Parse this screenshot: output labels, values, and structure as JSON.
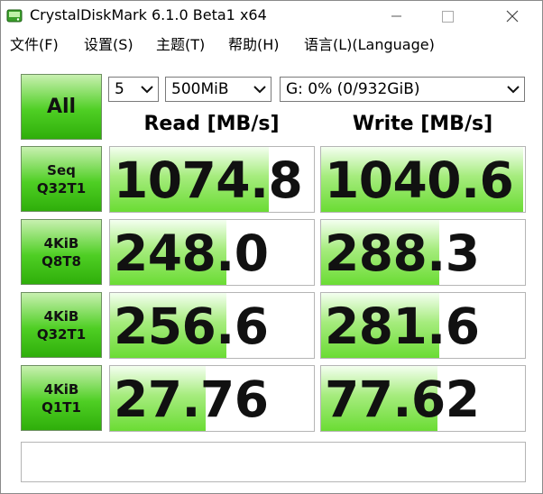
{
  "window": {
    "title": "CrystalDiskMark 6.1.0 Beta1 x64"
  },
  "menu": [
    "文件(F)",
    "设置(S)",
    "主题(T)",
    "帮助(H)",
    "语言(L)(Language)"
  ],
  "controls": {
    "all_label": "All",
    "count": "5",
    "size": "500MiB",
    "drive": "G: 0% (0/932GiB)"
  },
  "columns": {
    "read": "Read [MB/s]",
    "write": "Write [MB/s]"
  },
  "tests": [
    {
      "line1": "Seq",
      "line2": "Q32T1",
      "read": "1074.8",
      "write": "1040.6",
      "read_fill": 0.78,
      "write_fill": 0.99
    },
    {
      "line1": "4KiB",
      "line2": "Q8T8",
      "read": "248.0",
      "write": "288.3",
      "read_fill": 0.57,
      "write_fill": 0.58
    },
    {
      "line1": "4KiB",
      "line2": "Q32T1",
      "read": "256.6",
      "write": "281.6",
      "read_fill": 0.57,
      "write_fill": 0.58
    },
    {
      "line1": "4KiB",
      "line2": "Q1T1",
      "read": "27.76",
      "write": "77.62",
      "read_fill": 0.47,
      "write_fill": 0.57
    }
  ],
  "status_text": "",
  "colors": {
    "accent_green": "#4fcf24",
    "fill_green": "#6bdc34"
  }
}
